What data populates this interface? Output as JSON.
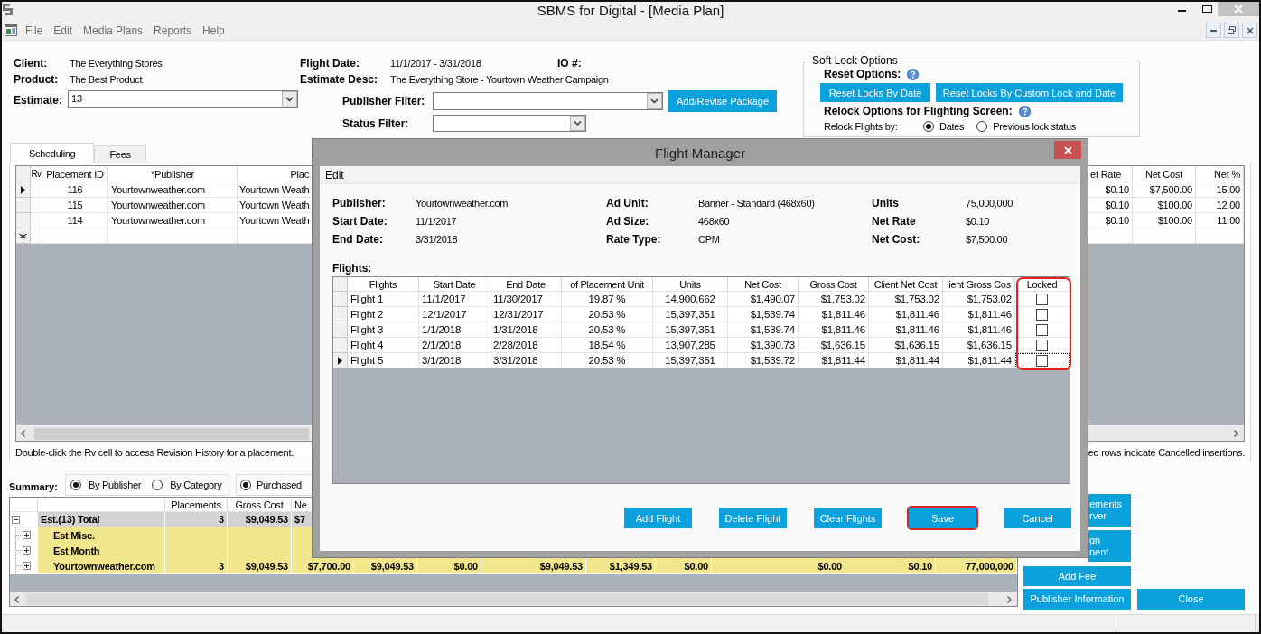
{
  "window": {
    "title": "SBMS for Digital - [Media Plan]"
  },
  "menu": [
    "File",
    "Edit",
    "Media Plans",
    "Reports",
    "Help"
  ],
  "header": {
    "client": {
      "label": "Client:",
      "value": "The Everything Stores"
    },
    "product": {
      "label": "Product:",
      "value": "The Best Product"
    },
    "estimate": {
      "label": "Estimate:",
      "value": "13"
    },
    "flight_date": {
      "label": "Flight Date:",
      "value": "11/1/2017 - 3/31/2018"
    },
    "io_number": {
      "label": "IO #:"
    },
    "estimate_desc": {
      "label": "Estimate Desc:",
      "value": "The Everything Store - Yourtown Weather Campaign"
    },
    "publisher_filter": {
      "label": "Publisher Filter:"
    },
    "status_filter": {
      "label": "Status Filter:"
    },
    "package_button": "Add/Revise Package"
  },
  "soft_lock": {
    "title": "Soft Lock Options",
    "reset_label": "Reset Options:",
    "reset_buttons": [
      "Reset Locks By Date",
      "Reset Locks By Custom Lock and Date"
    ],
    "relock_label": "Relock Options for Flighting Screen:",
    "relock_by_label": "Relock Flights by:",
    "relock_options": [
      {
        "label": "Dates",
        "selected": true
      },
      {
        "label": "Previous lock status",
        "selected": false
      }
    ]
  },
  "tabs": [
    {
      "label": "Scheduling",
      "selected": true
    },
    {
      "label": "Fees",
      "selected": false
    }
  ],
  "placements": {
    "columns": [
      "Rv",
      "Placement ID",
      "*Publisher",
      "Plac",
      "et Rate",
      "Net Cost",
      "Net %"
    ],
    "rows": [
      {
        "current": true,
        "cells": [
          "",
          "116",
          "Yourtownweather.com",
          "Yourtown Weath",
          "$0.10",
          "$7,500.00",
          "15.00"
        ]
      },
      {
        "current": false,
        "cells": [
          "",
          "115",
          "Yourtownweather.com",
          "Yourtown Weath",
          "$0.10",
          "$100.00",
          "12.00"
        ]
      },
      {
        "current": false,
        "cells": [
          "",
          "114",
          "Yourtownweather.com",
          "Yourtown Weath",
          "$0.10",
          "$100.00",
          "11.00"
        ]
      }
    ],
    "new_row": true,
    "note": "Double-click the Rv cell to access Revision History for a placement.",
    "note_2": "ed rows indicate Cancelled insertions."
  },
  "summary": {
    "label": "Summary:",
    "view_options": [
      {
        "label": "By Publisher",
        "selected": true
      },
      {
        "label": "By Category",
        "selected": false
      }
    ],
    "status_options": [
      {
        "label": "Purchased",
        "selected": true
      }
    ],
    "columns": [
      "Placements",
      "Gross Cost",
      "Ne"
    ],
    "rows": [
      {
        "name": "Est.(13) Total",
        "expanded": true,
        "cells": [
          "3",
          "$9,049.53",
          "$7"
        ],
        "children": [
          {
            "name": "Est Misc.",
            "expanded": false
          },
          {
            "name": "Est Month",
            "expanded": false
          },
          {
            "name": "Yourtownweather.com",
            "expanded": false,
            "cells": [
              "3",
              "$9,049.53",
              "$7,700.00",
              "$9,049.53",
              "$0.00",
              "$9,049.53",
              "$1,349.53",
              "$0.00",
              "$0.00",
              "$0.10",
              "77,000,000"
            ]
          }
        ]
      }
    ]
  },
  "side_buttons": [
    {
      "lines": [
        "ements",
        "rver"
      ]
    },
    {
      "lines": [
        "gn",
        "nent"
      ]
    },
    {
      "lines": [
        "Add Fee"
      ]
    },
    {
      "lines": [
        "Publisher Information"
      ]
    },
    {
      "lines": [
        "Close"
      ]
    }
  ],
  "flight_manager": {
    "title": "Flight Manager",
    "menu": [
      "Edit"
    ],
    "info": [
      [
        {
          "label": "Publisher:",
          "value": "Yourtownweather.com"
        },
        {
          "label": "Start Date:",
          "value": "11/1/2017"
        },
        {
          "label": "End Date:",
          "value": "3/31/2018"
        }
      ],
      [
        {
          "label": "Ad Unit:",
          "value": "Banner - Standard (468x60)"
        },
        {
          "label": "Ad Size:",
          "value": "468x60"
        },
        {
          "label": "Rate Type:",
          "value": "CPM"
        }
      ],
      [
        {
          "label": "Units",
          "value": "75,000,000"
        },
        {
          "label": "Net Rate",
          "value": "$0.10"
        },
        {
          "label": "Net Cost:",
          "value": "$7,500.00"
        }
      ]
    ],
    "flights_label": "Flights:",
    "columns": [
      {
        "label": "Flights",
        "highlighted": false
      },
      {
        "label": "Start Date",
        "highlighted": false
      },
      {
        "label": "End Date",
        "highlighted": false
      },
      {
        "label": "of Placement Unit",
        "highlighted": false
      },
      {
        "label": "Units",
        "highlighted": false
      },
      {
        "label": "Net Cost",
        "highlighted": false
      },
      {
        "label": "Gross Cost",
        "highlighted": false
      },
      {
        "label": "Client Net Cost",
        "highlighted": false
      },
      {
        "label": "lient Gross Cos",
        "highlighted": false
      },
      {
        "label": "Locked",
        "highlighted": true
      }
    ],
    "rows": [
      {
        "current": false,
        "locked": false,
        "cells": [
          "Flight 1",
          "11/1/2017",
          "11/30/2017",
          "19.87 %",
          "14,900,662",
          "$1,490.07",
          "$1,753.02",
          "$1,753.02",
          "$1,753.02"
        ]
      },
      {
        "current": false,
        "locked": false,
        "cells": [
          "Flight 2",
          "12/1/2017",
          "12/31/2017",
          "20.53 %",
          "15,397,351",
          "$1,539.74",
          "$1,811.46",
          "$1,811.46",
          "$1,811.46"
        ]
      },
      {
        "current": false,
        "locked": false,
        "cells": [
          "Flight 3",
          "1/1/2018",
          "1/31/2018",
          "20.53 %",
          "15,397,351",
          "$1,539.74",
          "$1,811.46",
          "$1,811.46",
          "$1,811.46"
        ]
      },
      {
        "current": false,
        "locked": false,
        "cells": [
          "Flight 4",
          "2/1/2018",
          "2/28/2018",
          "18.54 %",
          "13,907,285",
          "$1,390.73",
          "$1,636.15",
          "$1,636.15",
          "$1,636.15"
        ]
      },
      {
        "current": true,
        "locked": false,
        "cells": [
          "Flight 5",
          "3/1/2018",
          "3/31/2018",
          "20.53 %",
          "15,397,351",
          "$1,539.72",
          "$1,811.44",
          "$1,811.44",
          "$1,811.44"
        ]
      }
    ],
    "buttons": [
      {
        "label": "Add Flight",
        "highlighted": false
      },
      {
        "label": "Delete Flight",
        "highlighted": false
      },
      {
        "label": "Clear Flights",
        "highlighted": false
      },
      {
        "label": "Save",
        "highlighted": true
      },
      {
        "label": "Cancel",
        "highlighted": false
      }
    ]
  }
}
